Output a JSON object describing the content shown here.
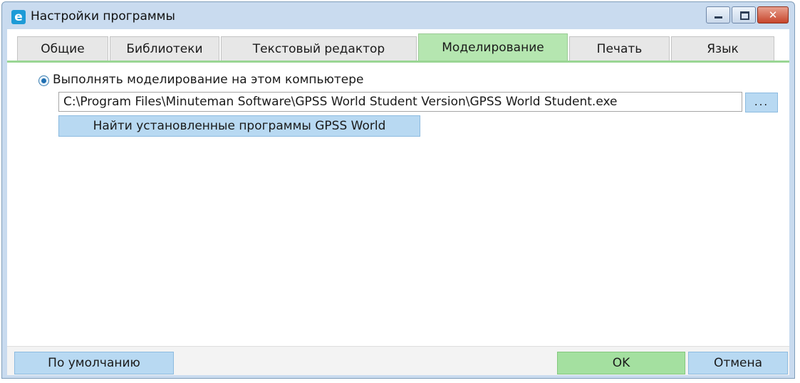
{
  "window": {
    "icon_letter": "e",
    "title": "Настройки программы",
    "controls": {
      "minimize": "minimize",
      "maximize": "maximize",
      "close_glyph": "✕"
    }
  },
  "tabs": [
    {
      "label": "Общие",
      "active": false
    },
    {
      "label": "Библиотеки",
      "active": false
    },
    {
      "label": "Текстовый редактор",
      "active": false
    },
    {
      "label": "Моделирование",
      "active": true
    },
    {
      "label": "Печать",
      "active": false
    },
    {
      "label": "Язык",
      "active": false
    }
  ],
  "modeling": {
    "radio_label": "Выполнять моделирование на этом компьютере",
    "radio_checked": true,
    "path_value": "C:\\Program Files\\Minuteman Software\\GPSS World Student Version\\GPSS World Student.exe",
    "browse_label": "...",
    "find_button": "Найти установленные программы GPSS World"
  },
  "footer": {
    "default_button": "По умолчанию",
    "ok_button": "OK",
    "cancel_button": "Отмена"
  },
  "colors": {
    "active_tab": "#b5e6b0",
    "button_blue": "#b8d9f2",
    "ok_green": "#a4e0a0",
    "frame": "#c9dbef"
  }
}
